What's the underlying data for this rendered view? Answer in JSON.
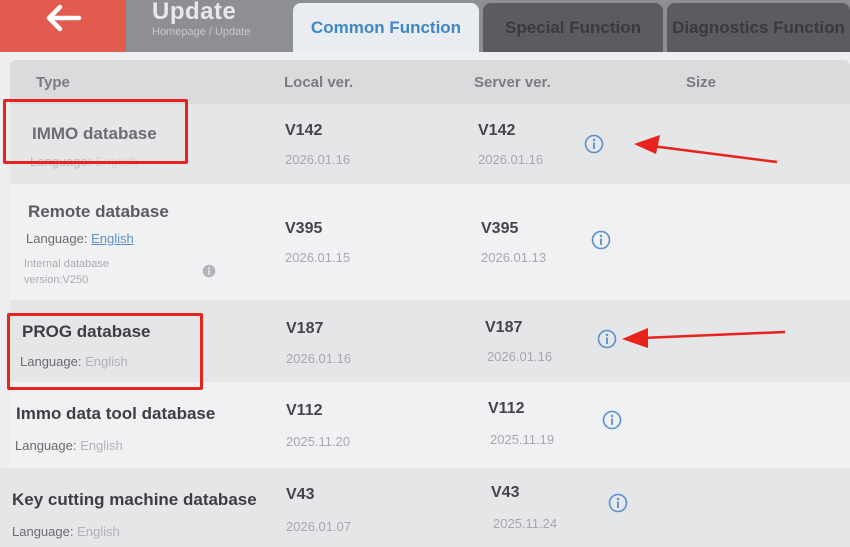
{
  "header": {
    "title": "Update",
    "breadcrumb": "Homepage / Update",
    "tabs": [
      "Common Function",
      "Special Function",
      "Diagnostics Function"
    ]
  },
  "table": {
    "columns": [
      "Type",
      "Local ver.",
      "Server ver.",
      "Size"
    ],
    "rows": [
      {
        "name": "IMMO database",
        "language_label": "Language:",
        "language": "English",
        "local_ver": "V142",
        "local_date": "2026.01.16",
        "server_ver": "V142",
        "server_date": "2026.01.16"
      },
      {
        "name": "Remote database",
        "language_label": "Language:",
        "language": "English",
        "note": "Internal database version:V250",
        "local_ver": "V395",
        "local_date": "2026.01.15",
        "server_ver": "V395",
        "server_date": "2026.01.13"
      },
      {
        "name": "PROG database",
        "language_label": "Language:",
        "language": "English",
        "local_ver": "V187",
        "local_date": "2026.01.16",
        "server_ver": "V187",
        "server_date": "2026.01.16"
      },
      {
        "name": "Immo data tool database",
        "language_label": "Language:",
        "language": "English",
        "local_ver": "V112",
        "local_date": "2025.11.20",
        "server_ver": "V112",
        "server_date": "2025.11.19"
      },
      {
        "name": "Key cutting machine database",
        "language_label": "Language:",
        "language": "English",
        "local_ver": "V43",
        "local_date": "2026.01.07",
        "server_ver": "V43",
        "server_date": "2025.11.24"
      }
    ]
  },
  "colors": {
    "accent": "#3f86c4",
    "back_button": "#e35a4f",
    "highlight": "#e8221c"
  }
}
